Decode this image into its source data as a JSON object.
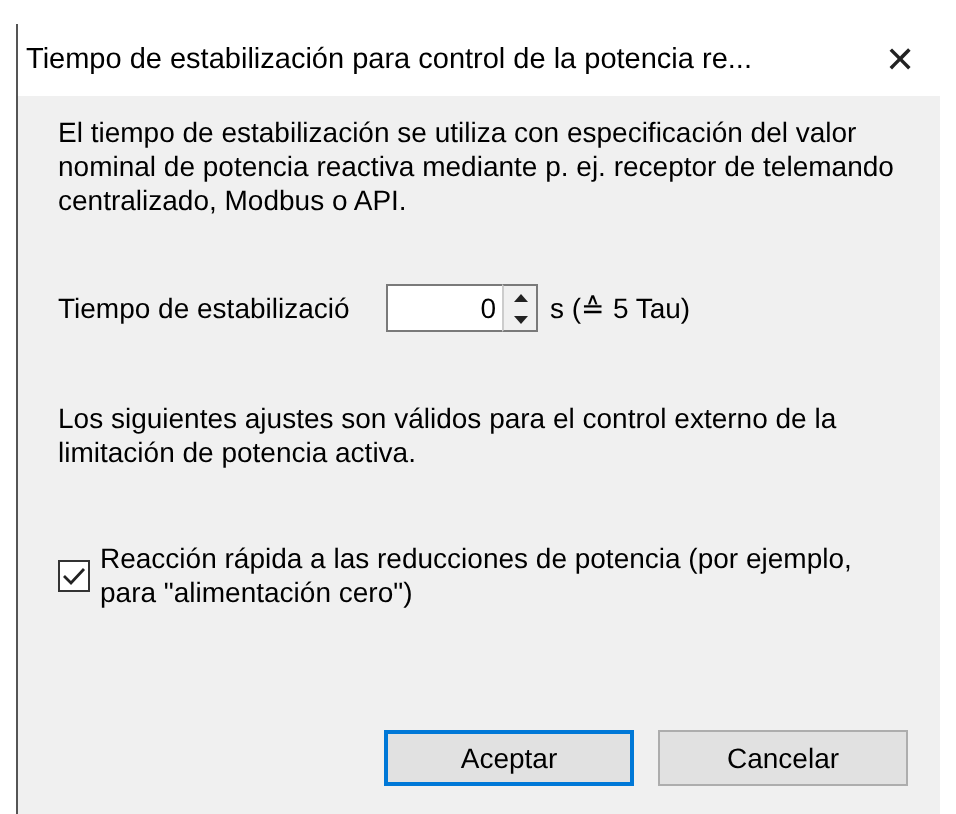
{
  "window": {
    "title": "Tiempo de estabilización para control de la potencia re...",
    "close": "✕"
  },
  "intro": "El tiempo de estabilización se utiliza con especificación del valor nominal de potencia reactiva mediante p. ej. receptor de telemando centralizado, Modbus o API.",
  "settling": {
    "label": "Tiempo de estabilizació",
    "value": "0",
    "unit": "s (≙ 5 Tau)"
  },
  "note": "Los siguientes ajustes son válidos para el control externo de la limitación de potencia activa.",
  "fast_reaction": {
    "label": "Reacción rápida a las reducciones de potencia (por ejemplo, para \"alimentación cero\")",
    "checked": true
  },
  "buttons": [
    {
      "label": "Aceptar",
      "selected": true
    },
    {
      "label": "Cancelar",
      "selected": false
    }
  ]
}
